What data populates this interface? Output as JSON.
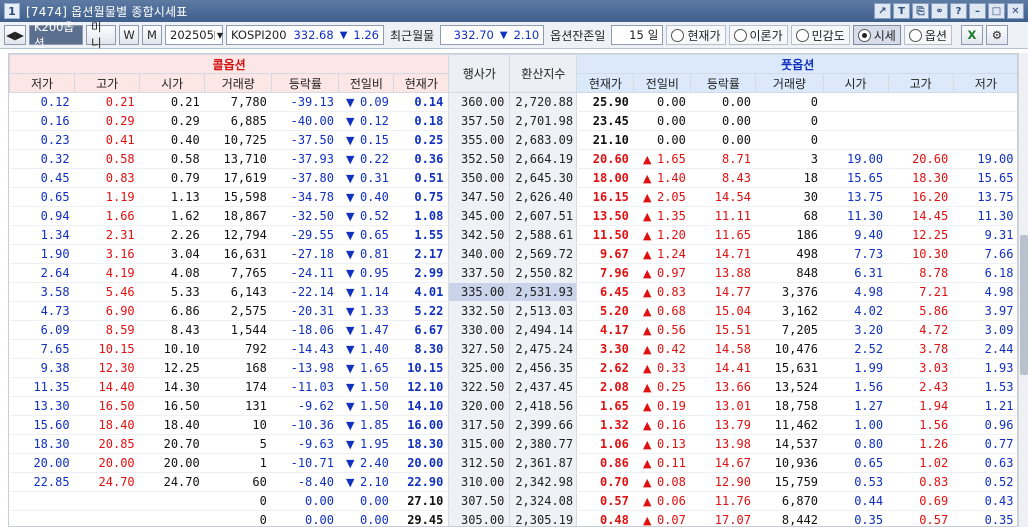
{
  "window": {
    "title": "[7474] 옵션월물별 종합시세표",
    "icon_label": "1",
    "icons": [
      "export-icon",
      "text-icon",
      "copy-icon",
      "link-icon",
      "help-icon",
      "minimize-icon",
      "maximize-icon",
      "close-icon"
    ]
  },
  "toolbar": {
    "nav_arrows": "◀▶",
    "tabs": [
      "K200옵션",
      "미니",
      "W",
      "M"
    ],
    "month": "202505",
    "index_name": "KOSPI200",
    "index_value": "332.68",
    "index_arrow": "▼",
    "index_change": "1.26",
    "near_label": "최근월물",
    "near_value": "332.70",
    "near_arrow": "▼",
    "near_change": "2.10",
    "remain_label": "옵션잔존일",
    "remain_value": "15",
    "remain_unit": "일",
    "radios": [
      "현재가",
      "이론가",
      "민감도",
      "시세",
      "옵션"
    ],
    "selected_radio": "시세"
  },
  "headers": {
    "call": "콜옵션",
    "put": "풋옵션",
    "strike": "행사가",
    "conv": "환산지수",
    "call_cols": [
      "저가",
      "고가",
      "시가",
      "거래량",
      "등락률",
      "전일비",
      "현재가"
    ],
    "put_cols": [
      "현재가",
      "전일비",
      "등락률",
      "거래량",
      "시가",
      "고가",
      "저가"
    ]
  },
  "rows": [
    {
      "cl": "0.12",
      "ch": "0.21",
      "co": "0.21",
      "cv": "7,780",
      "cr": "-39.13",
      "ca": "▼",
      "cd": "0.09",
      "cp": "0.14",
      "k": "360.00",
      "x": "2,720.88",
      "pp": "25.90",
      "pa": "",
      "pd": "0.00",
      "pr": "0.00",
      "pv": "0",
      "po": "",
      "ph": "",
      "pl": ""
    },
    {
      "cl": "0.16",
      "ch": "0.29",
      "co": "0.29",
      "cv": "6,885",
      "cr": "-40.00",
      "ca": "▼",
      "cd": "0.12",
      "cp": "0.18",
      "k": "357.50",
      "x": "2,701.98",
      "pp": "23.45",
      "pa": "",
      "pd": "0.00",
      "pr": "0.00",
      "pv": "0",
      "po": "",
      "ph": "",
      "pl": ""
    },
    {
      "cl": "0.23",
      "ch": "0.41",
      "co": "0.40",
      "cv": "10,725",
      "cr": "-37.50",
      "ca": "▼",
      "cd": "0.15",
      "cp": "0.25",
      "k": "355.00",
      "x": "2,683.09",
      "pp": "21.10",
      "pa": "",
      "pd": "0.00",
      "pr": "0.00",
      "pv": "0",
      "po": "",
      "ph": "",
      "pl": ""
    },
    {
      "cl": "0.32",
      "ch": "0.58",
      "co": "0.58",
      "cv": "13,710",
      "cr": "-37.93",
      "ca": "▼",
      "cd": "0.22",
      "cp": "0.36",
      "k": "352.50",
      "x": "2,664.19",
      "pp": "20.60",
      "pa": "▲",
      "pd": "1.65",
      "pr": "8.71",
      "pv": "3",
      "po": "19.00",
      "ph": "20.60",
      "pl": "19.00"
    },
    {
      "cl": "0.45",
      "ch": "0.83",
      "co": "0.79",
      "cv": "17,619",
      "cr": "-37.80",
      "ca": "▼",
      "cd": "0.31",
      "cp": "0.51",
      "k": "350.00",
      "x": "2,645.30",
      "pp": "18.00",
      "pa": "▲",
      "pd": "1.40",
      "pr": "8.43",
      "pv": "18",
      "po": "15.65",
      "ph": "18.30",
      "pl": "15.65"
    },
    {
      "cl": "0.65",
      "ch": "1.19",
      "co": "1.13",
      "cv": "15,598",
      "cr": "-34.78",
      "ca": "▼",
      "cd": "0.40",
      "cp": "0.75",
      "k": "347.50",
      "x": "2,626.40",
      "pp": "16.15",
      "pa": "▲",
      "pd": "2.05",
      "pr": "14.54",
      "pv": "30",
      "po": "13.75",
      "ph": "16.20",
      "pl": "13.75"
    },
    {
      "cl": "0.94",
      "ch": "1.66",
      "co": "1.62",
      "cv": "18,867",
      "cr": "-32.50",
      "ca": "▼",
      "cd": "0.52",
      "cp": "1.08",
      "k": "345.00",
      "x": "2,607.51",
      "pp": "13.50",
      "pa": "▲",
      "pd": "1.35",
      "pr": "11.11",
      "pv": "68",
      "po": "11.30",
      "ph": "14.45",
      "pl": "11.30"
    },
    {
      "cl": "1.34",
      "ch": "2.31",
      "co": "2.26",
      "cv": "12,794",
      "cr": "-29.55",
      "ca": "▼",
      "cd": "0.65",
      "cp": "1.55",
      "k": "342.50",
      "x": "2,588.61",
      "pp": "11.50",
      "pa": "▲",
      "pd": "1.20",
      "pr": "11.65",
      "pv": "186",
      "po": "9.40",
      "ph": "12.25",
      "pl": "9.31"
    },
    {
      "cl": "1.90",
      "ch": "3.16",
      "co": "3.04",
      "cv": "16,631",
      "cr": "-27.18",
      "ca": "▼",
      "cd": "0.81",
      "cp": "2.17",
      "k": "340.00",
      "x": "2,569.72",
      "pp": "9.67",
      "pa": "▲",
      "pd": "1.24",
      "pr": "14.71",
      "pv": "498",
      "po": "7.73",
      "ph": "10.30",
      "pl": "7.66"
    },
    {
      "cl": "2.64",
      "ch": "4.19",
      "co": "4.08",
      "cv": "7,765",
      "cr": "-24.11",
      "ca": "▼",
      "cd": "0.95",
      "cp": "2.99",
      "k": "337.50",
      "x": "2,550.82",
      "pp": "7.96",
      "pa": "▲",
      "pd": "0.97",
      "pr": "13.88",
      "pv": "848",
      "po": "6.31",
      "ph": "8.78",
      "pl": "6.18"
    },
    {
      "cl": "3.58",
      "ch": "5.46",
      "co": "5.33",
      "cv": "6,143",
      "cr": "-22.14",
      "ca": "▼",
      "cd": "1.14",
      "cp": "4.01",
      "k": "335.00",
      "x": "2,531.93",
      "pp": "6.45",
      "pa": "▲",
      "pd": "0.83",
      "pr": "14.77",
      "pv": "3,376",
      "po": "4.98",
      "ph": "7.21",
      "pl": "4.98",
      "sel": true
    },
    {
      "cl": "4.73",
      "ch": "6.90",
      "co": "6.86",
      "cv": "2,575",
      "cr": "-20.31",
      "ca": "▼",
      "cd": "1.33",
      "cp": "5.22",
      "k": "332.50",
      "x": "2,513.03",
      "pp": "5.20",
      "pa": "▲",
      "pd": "0.68",
      "pr": "15.04",
      "pv": "3,162",
      "po": "4.02",
      "ph": "5.86",
      "pl": "3.97"
    },
    {
      "cl": "6.09",
      "ch": "8.59",
      "co": "8.43",
      "cv": "1,544",
      "cr": "-18.06",
      "ca": "▼",
      "cd": "1.47",
      "cp": "6.67",
      "k": "330.00",
      "x": "2,494.14",
      "pp": "4.17",
      "pa": "▲",
      "pd": "0.56",
      "pr": "15.51",
      "pv": "7,205",
      "po": "3.20",
      "ph": "4.72",
      "pl": "3.09"
    },
    {
      "cl": "7.65",
      "ch": "10.15",
      "co": "10.10",
      "cv": "792",
      "cr": "-14.43",
      "ca": "▼",
      "cd": "1.40",
      "cp": "8.30",
      "k": "327.50",
      "x": "2,475.24",
      "pp": "3.30",
      "pa": "▲",
      "pd": "0.42",
      "pr": "14.58",
      "pv": "10,476",
      "po": "2.52",
      "ph": "3.78",
      "pl": "2.44"
    },
    {
      "cl": "9.38",
      "ch": "12.30",
      "co": "12.25",
      "cv": "168",
      "cr": "-13.98",
      "ca": "▼",
      "cd": "1.65",
      "cp": "10.15",
      "k": "325.00",
      "x": "2,456.35",
      "pp": "2.62",
      "pa": "▲",
      "pd": "0.33",
      "pr": "14.41",
      "pv": "15,631",
      "po": "1.99",
      "ph": "3.03",
      "pl": "1.93"
    },
    {
      "cl": "11.35",
      "ch": "14.40",
      "co": "14.30",
      "cv": "174",
      "cr": "-11.03",
      "ca": "▼",
      "cd": "1.50",
      "cp": "12.10",
      "k": "322.50",
      "x": "2,437.45",
      "pp": "2.08",
      "pa": "▲",
      "pd": "0.25",
      "pr": "13.66",
      "pv": "13,524",
      "po": "1.56",
      "ph": "2.43",
      "pl": "1.53"
    },
    {
      "cl": "13.30",
      "ch": "16.50",
      "co": "16.50",
      "cv": "131",
      "cr": "-9.62",
      "ca": "▼",
      "cd": "1.50",
      "cp": "14.10",
      "k": "320.00",
      "x": "2,418.56",
      "pp": "1.65",
      "pa": "▲",
      "pd": "0.19",
      "pr": "13.01",
      "pv": "18,758",
      "po": "1.27",
      "ph": "1.94",
      "pl": "1.21"
    },
    {
      "cl": "15.60",
      "ch": "18.40",
      "co": "18.40",
      "cv": "10",
      "cr": "-10.36",
      "ca": "▼",
      "cd": "1.85",
      "cp": "16.00",
      "k": "317.50",
      "x": "2,399.66",
      "pp": "1.32",
      "pa": "▲",
      "pd": "0.16",
      "pr": "13.79",
      "pv": "11,462",
      "po": "1.00",
      "ph": "1.56",
      "pl": "0.96"
    },
    {
      "cl": "18.30",
      "ch": "20.85",
      "co": "20.70",
      "cv": "5",
      "cr": "-9.63",
      "ca": "▼",
      "cd": "1.95",
      "cp": "18.30",
      "k": "315.00",
      "x": "2,380.77",
      "pp": "1.06",
      "pa": "▲",
      "pd": "0.13",
      "pr": "13.98",
      "pv": "14,537",
      "po": "0.80",
      "ph": "1.26",
      "pl": "0.77"
    },
    {
      "cl": "20.00",
      "ch": "20.00",
      "co": "20.00",
      "cv": "1",
      "cr": "-10.71",
      "ca": "▼",
      "cd": "2.40",
      "cp": "20.00",
      "k": "312.50",
      "x": "2,361.87",
      "pp": "0.86",
      "pa": "▲",
      "pd": "0.11",
      "pr": "14.67",
      "pv": "10,936",
      "po": "0.65",
      "ph": "1.02",
      "pl": "0.63"
    },
    {
      "cl": "22.85",
      "ch": "24.70",
      "co": "24.70",
      "cv": "60",
      "cr": "-8.40",
      "ca": "▼",
      "cd": "2.10",
      "cp": "22.90",
      "k": "310.00",
      "x": "2,342.98",
      "pp": "0.70",
      "pa": "▲",
      "pd": "0.08",
      "pr": "12.90",
      "pv": "15,759",
      "po": "0.53",
      "ph": "0.83",
      "pl": "0.52"
    },
    {
      "cl": "",
      "ch": "",
      "co": "",
      "cv": "0",
      "cr": "0.00",
      "ca": "",
      "cd": "0.00",
      "cp": "27.10",
      "k": "307.50",
      "x": "2,324.08",
      "pp": "0.57",
      "pa": "▲",
      "pd": "0.06",
      "pr": "11.76",
      "pv": "6,870",
      "po": "0.44",
      "ph": "0.69",
      "pl": "0.43"
    },
    {
      "cl": "",
      "ch": "",
      "co": "",
      "cv": "0",
      "cr": "0.00",
      "ca": "",
      "cd": "0.00",
      "cp": "29.45",
      "k": "305.00",
      "x": "2,305.19",
      "pp": "0.48",
      "pa": "▲",
      "pd": "0.07",
      "pr": "17.07",
      "pv": "8,442",
      "po": "0.35",
      "ph": "0.57",
      "pl": "0.35"
    }
  ],
  "colors": {
    "up": "#e01010",
    "down": "#1030c0",
    "call_header_bg": "#fde6e6",
    "put_header_bg": "#dbe9fb"
  }
}
